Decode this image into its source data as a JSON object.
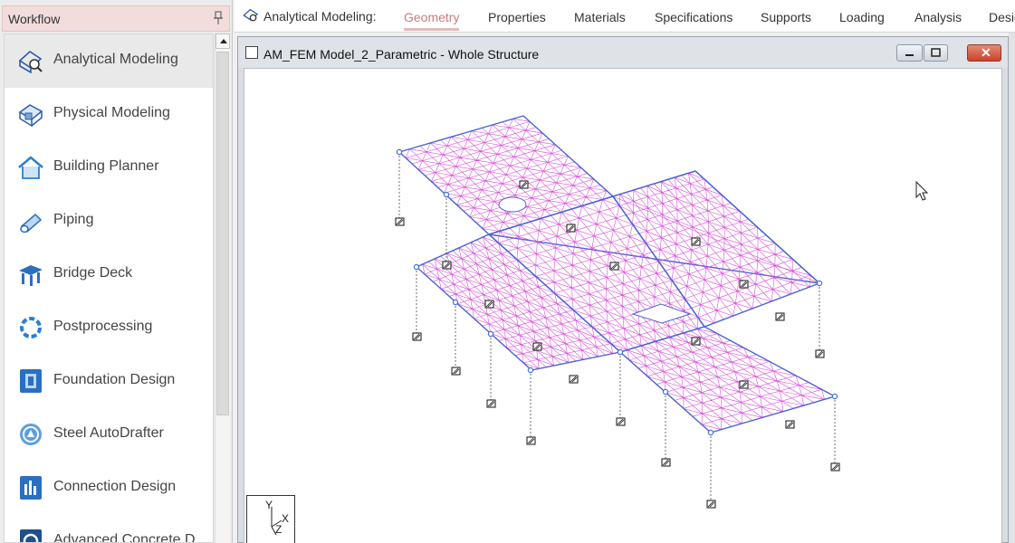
{
  "workflow": {
    "title": "Workflow",
    "items": [
      {
        "label": "Analytical Modeling",
        "icon": "analytical-modeling-icon",
        "active": true
      },
      {
        "label": "Physical Modeling",
        "icon": "physical-modeling-icon"
      },
      {
        "label": "Building Planner",
        "icon": "house-icon"
      },
      {
        "label": "Piping",
        "icon": "pipe-icon"
      },
      {
        "label": "Bridge Deck",
        "icon": "bridge-icon"
      },
      {
        "label": "Postprocessing",
        "icon": "postprocessing-icon"
      },
      {
        "label": "Foundation Design",
        "icon": "foundation-icon"
      },
      {
        "label": "Steel AutoDrafter",
        "icon": "steel-autodrafter-icon"
      },
      {
        "label": "Connection Design",
        "icon": "connection-icon"
      },
      {
        "label": "Advanced Concrete D",
        "icon": "concrete-icon"
      }
    ]
  },
  "ribbon": {
    "lead": "Analytical Modeling:",
    "tabs": [
      "Geometry",
      "Properties",
      "Materials",
      "Specifications",
      "Supports",
      "Loading",
      "Analysis",
      "Desig"
    ],
    "active_tab": "Geometry"
  },
  "window": {
    "title": "AM_FEM Model_2_Parametric - Whole Structure",
    "close_glyph": "✕"
  },
  "axes": {
    "y": "Y",
    "x": "X",
    "z": "Z"
  },
  "colors": {
    "mesh": "#d84fd8",
    "edge": "#4b63d6",
    "node": "#3f6fe0",
    "header_bg": "#f2dcdc",
    "active_tab": "#c97d7d"
  }
}
